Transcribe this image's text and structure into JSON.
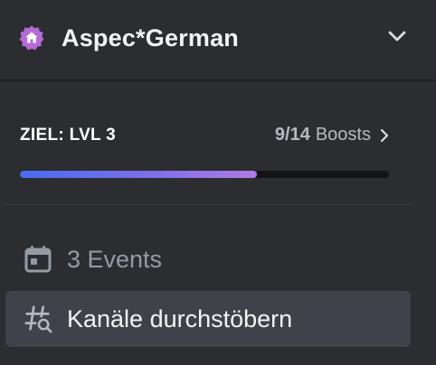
{
  "header": {
    "server_name": "Aspec*German",
    "badge_icon": "home-badge-icon",
    "chevron_icon": "chevron-down-icon"
  },
  "boost": {
    "goal_label": "ZIEL: LVL 3",
    "current": "9/14",
    "unit_label": "Boosts",
    "progress_fraction": 0.643,
    "chevron_icon": "chevron-right-icon"
  },
  "items": [
    {
      "label": "3 Events",
      "icon": "calendar-icon"
    },
    {
      "label": "Kanäle durchstöbern",
      "icon": "channel-browse-icon"
    }
  ],
  "colors": {
    "background": "#2b2d31",
    "badge": "#b56bd6",
    "progress_start": "#4a6cf0",
    "progress_end": "#b07be6",
    "selected_item": "#404249"
  }
}
